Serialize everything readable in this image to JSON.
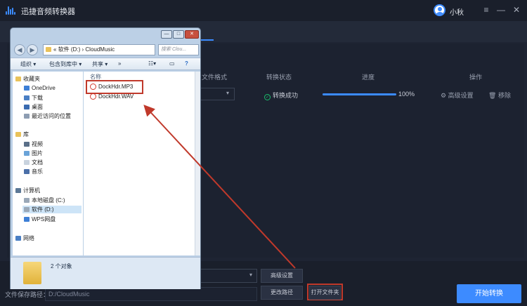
{
  "app": {
    "title": "迅捷音频转换器",
    "user": "小秋"
  },
  "table": {
    "headers": {
      "format": "文件格式",
      "status": "转换状态",
      "progress": "进度",
      "actions": "操作"
    },
    "row": {
      "status": "转换成功",
      "progress_value": 1.0,
      "progress_label": "100%",
      "settings": "高级设置",
      "remove": "移除"
    }
  },
  "bottom": {
    "advanced_settings": "高级设置",
    "save_label": "文件保存路径：",
    "save_path": "D:/CloudMusic",
    "change_path": "更改路径",
    "open_folder": "打开文件夹",
    "start_convert": "开始转换"
  },
  "explorer": {
    "address_parts": [
      "«",
      "软件 (D:)",
      "›",
      "CloudMusic"
    ],
    "search_placeholder": "搜索 Clou...",
    "toolbar": {
      "organize": "组织 ▾",
      "include_in_library": "包含到库中 ▾",
      "share": "共享 ▾",
      "new_folder": "»"
    },
    "column_name": "名称",
    "nav": {
      "favorites": "收藏夹",
      "onedrive": "OneDrive",
      "downloads": "下载",
      "desktop": "桌面",
      "recent": "最近访问的位置",
      "libraries": "库",
      "videos": "视频",
      "pictures": "图片",
      "documents": "文档",
      "music": "音乐",
      "computer": "计算机",
      "local_disk_c": "本地磁盘 (C:)",
      "software_d": "软件 (D:)",
      "wps": "WPS网盘",
      "network": "网络"
    },
    "files": [
      "DockHdr.MP3",
      "DockHdr.WAV"
    ],
    "item_count": "2 个对象"
  },
  "colors": {
    "accent": "#3d8bff",
    "highlight": "#c0392b",
    "success": "#19be6b"
  }
}
